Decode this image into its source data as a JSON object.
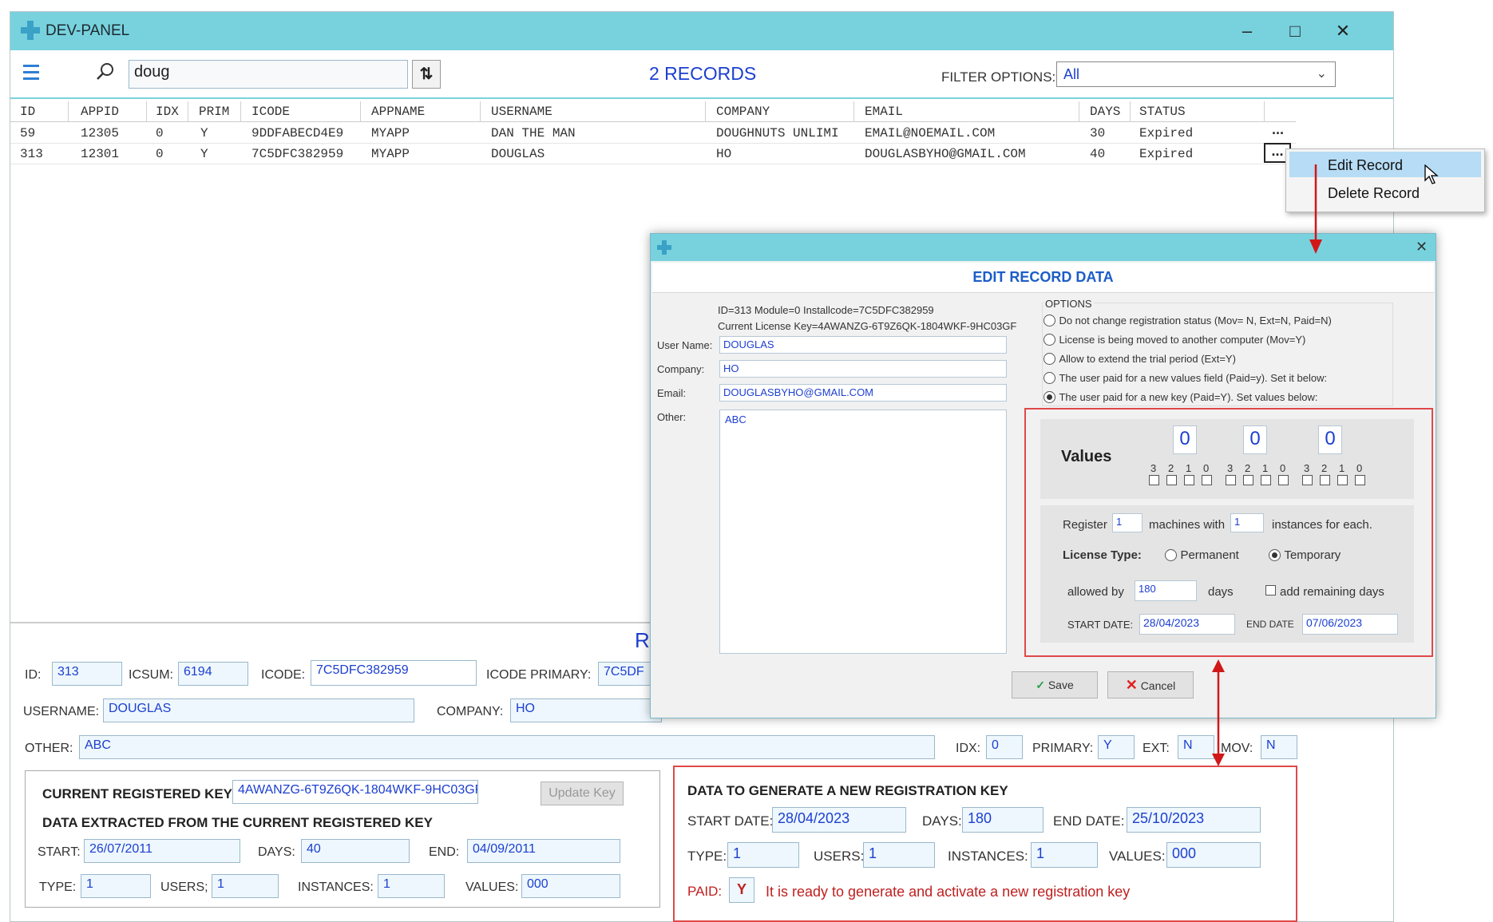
{
  "window": {
    "title": "DEV-PANEL"
  },
  "toolbar": {
    "search_value": "doug",
    "record_count": "2 RECORDS",
    "filter_label": "FILTER OPTIONS:",
    "filter_value": "All"
  },
  "grid": {
    "columns": [
      "ID",
      "APPID",
      "IDX",
      "PRIM",
      "ICODE",
      "APPNAME",
      "USERNAME",
      "COMPANY",
      "EMAIL",
      "DAYS",
      "STATUS"
    ],
    "rows": [
      [
        "59",
        "12305",
        "0",
        "Y",
        "9DDFABECD4E9",
        "MYAPP",
        "DAN THE MAN",
        "DOUGHNUTS UNLIMI",
        "EMAIL@NOEMAIL.COM",
        "30",
        "Expired"
      ],
      [
        "313",
        "12301",
        "0",
        "Y",
        "7C5DFC382959",
        "MYAPP",
        "DOUGLAS",
        "HO",
        "DOUGLASBYHO@GMAIL.COM",
        "40",
        "Expired"
      ]
    ],
    "row_menu_glyph": "..."
  },
  "context_menu": {
    "items": [
      "Edit Record",
      "Delete Record"
    ]
  },
  "details": {
    "header_fragment": "R",
    "id_label": "ID:",
    "id": "313",
    "icsum_label": "ICSUM:",
    "icsum": "6194",
    "icode_label": "ICODE:",
    "icode": "7C5DFC382959",
    "icode_primary_label": "ICODE PRIMARY:",
    "icode_primary": "7C5DF",
    "username_label": "USERNAME:",
    "username": "DOUGLAS",
    "company_label": "COMPANY:",
    "company": "HO",
    "other_label": "OTHER:",
    "other": "ABC",
    "idx_label": "IDX:",
    "idx": "0",
    "primary_label": "PRIMARY:",
    "primary": "Y",
    "ext_label": "EXT:",
    "ext": "N",
    "mov_label": "MOV:",
    "mov": "N"
  },
  "current_key": {
    "label": "CURRENT REGISTERED KEY:",
    "value": "4AWANZG-6T9Z6QK-1804WKF-9HC03GF",
    "update_button": "Update Key",
    "extracted_title": "DATA EXTRACTED FROM THE CURRENT REGISTERED KEY",
    "start_label": "START:",
    "start": "26/07/2011",
    "days_label": "DAYS:",
    "days": "40",
    "end_label": "END:",
    "end": "04/09/2011",
    "type_label": "TYPE:",
    "type": "1",
    "users_label": "USERS;",
    "users": "1",
    "instances_label": "INSTANCES:",
    "instances": "1",
    "values_label": "VALUES:",
    "values": "000"
  },
  "new_key": {
    "title": "DATA TO GENERATE A NEW REGISTRATION KEY",
    "start_label": "START DATE:",
    "start": "28/04/2023",
    "days_label": "DAYS:",
    "days": "180",
    "end_label": "END DATE:",
    "end": "25/10/2023",
    "type_label": "TYPE:",
    "type": "1",
    "users_label": "USERS:",
    "users": "1",
    "instances_label": "INSTANCES:",
    "instances": "1",
    "values_label": "VALUES:",
    "values": "000",
    "paid_label": "PAID:",
    "paid": "Y",
    "message": "It is ready to generate and activate a new registration key"
  },
  "dialog": {
    "title": "EDIT RECORD DATA",
    "info_line1": "ID=313  Module=0  Installcode=7C5DFC382959",
    "info_line2": "Current License Key=4AWANZG-6T9Z6QK-1804WKF-9HC03GF",
    "user_name_label": "User Name:",
    "user_name": "DOUGLAS",
    "company_label": "Company:",
    "company": "HO",
    "email_label": "Email:",
    "email": "DOUGLASBYHO@GMAIL.COM",
    "other_label": "Other:",
    "other": "ABC",
    "options_title": "OPTIONS",
    "options": [
      "Do not change registration status (Mov= N, Ext=N, Paid=N)",
      "License is being moved to another computer (Mov=Y)",
      "Allow to extend the trial period (Ext=Y)",
      "The user paid for a new values field (Paid=y). Set it below:",
      "The user paid for a new key (Paid=Y). Set values below:"
    ],
    "selected_option": 4,
    "values_label": "Values",
    "value_digits": [
      "0",
      "0",
      "0"
    ],
    "bit_labels": [
      "3",
      "2",
      "1",
      "0"
    ],
    "register_label": "Register",
    "register": "1",
    "machines_label": "machines with",
    "machines": "1",
    "instances_label": "instances for each.",
    "license_type_label": "License Type:",
    "permanent_label": "Permanent",
    "temporary_label": "Temporary",
    "license_type_selected": "Temporary",
    "allowed_label": "allowed by",
    "allowed_days": "180",
    "days_label": "days",
    "add_remaining_label": "add remaining days",
    "start_label": "START DATE:",
    "start": "28/04/2023",
    "end_label": "END DATE",
    "end": "07/06/2023",
    "save_label": "Save",
    "cancel_label": "Cancel"
  },
  "colors": {
    "titlebar": "#78d2de",
    "accent_text": "#1c3fd0",
    "highlight_border": "#e04848",
    "arrow": "#d01818",
    "menu_highlight": "#b7dcf5"
  }
}
